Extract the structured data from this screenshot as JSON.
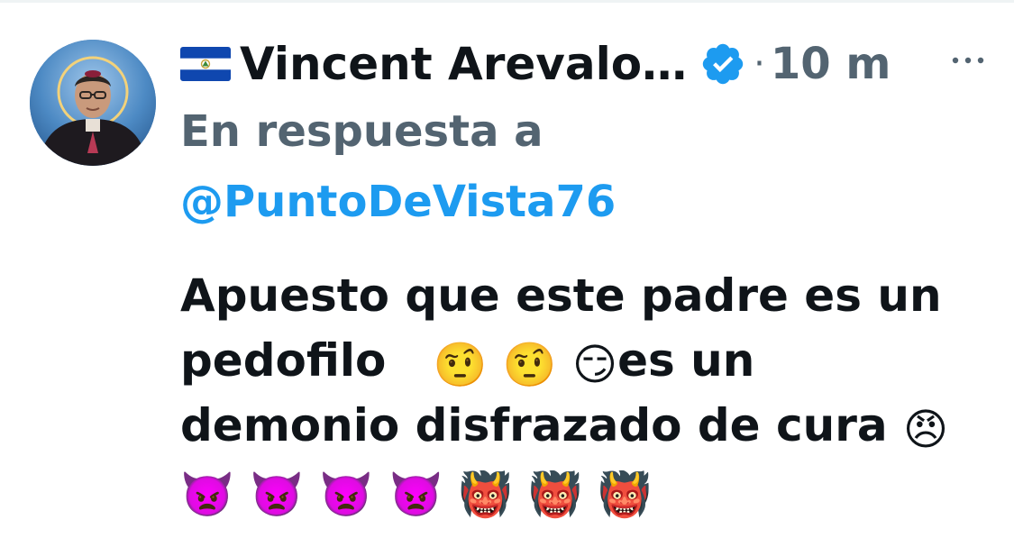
{
  "tweet": {
    "author": {
      "flag_icon": "el-salvador-flag-icon",
      "display_name": "Vincent Arevalo…",
      "verified_icon": "verified-badge-icon"
    },
    "separator": "·",
    "time": "10 m",
    "more_icon": "more-options-icon",
    "reply_label": "En respuesta a",
    "reply_handle": "@PuntoDeVista76",
    "body": {
      "line1": "Apuesto que este padre es un",
      "line2_text": "pedofilo",
      "line2_emojis": [
        "🤨",
        "🤨",
        "😏"
      ],
      "line2_tail": "es un",
      "line3_text": "demonio disfrazado de cura",
      "line3_emoji": "😠",
      "line4_emojis": [
        "👿",
        "👿",
        "👿",
        "👿",
        "👹",
        "👹",
        "👹"
      ]
    },
    "colors": {
      "text_primary": "#0f1419",
      "text_secondary": "#536471",
      "link": "#1d9bf0",
      "verified": "#1d9bf0"
    }
  }
}
